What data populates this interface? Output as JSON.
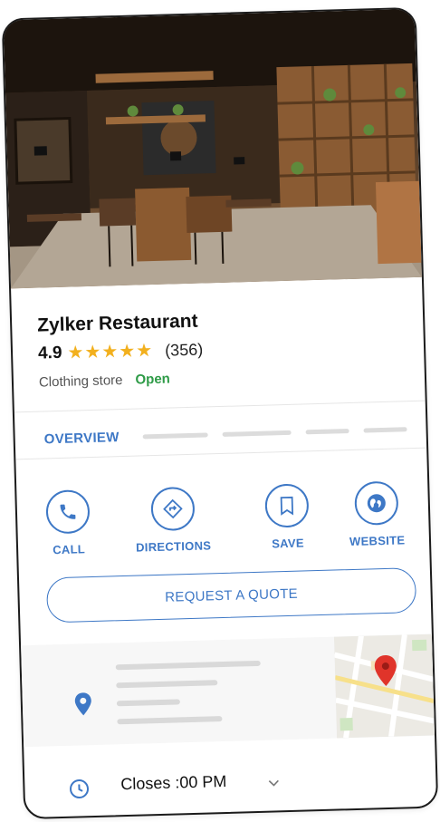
{
  "place": {
    "name": "Zylker Restaurant",
    "rating": "4.9",
    "stars": [
      "★",
      "★",
      "★",
      "★",
      "★"
    ],
    "review_count": "(356)",
    "category": "Clothing store",
    "status": "Open"
  },
  "tabs": {
    "active": "OVERVIEW"
  },
  "actions": [
    {
      "label": "CALL",
      "icon": "phone-icon"
    },
    {
      "label": "DIRECTIONS",
      "icon": "directions-icon"
    },
    {
      "label": "SAVE",
      "icon": "bookmark-icon"
    },
    {
      "label": "WEBSITE",
      "icon": "globe-icon"
    }
  ],
  "quote_button": "REQUEST A QUOTE",
  "hours": {
    "text": "Closes :00 PM"
  },
  "colors": {
    "accent": "#3e78c6",
    "star": "#f2b01e",
    "open": "#2e9b47",
    "map_pin": "#e0342a"
  }
}
